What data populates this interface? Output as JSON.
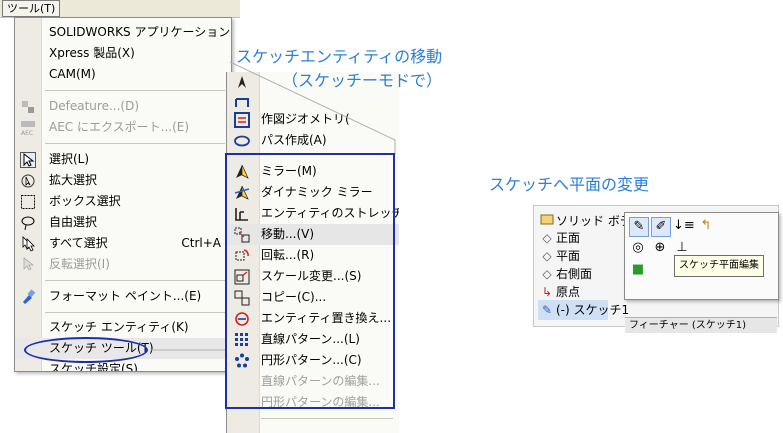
{
  "menubar": {
    "tools_menu": "ツール(T)"
  },
  "tools_menu_items": [
    {
      "label": "SOLIDWORKS アプリケーション(",
      "shortcut": "",
      "icon": "",
      "disabled": false
    },
    {
      "label": "Xpress 製品(X)",
      "shortcut": "",
      "icon": "",
      "disabled": false
    },
    {
      "label": "CAM(M)",
      "shortcut": "",
      "icon": "",
      "disabled": false
    },
    {
      "label": "Defeature...(D)",
      "shortcut": "",
      "icon": "defeature-icon",
      "disabled": true
    },
    {
      "label": "AEC にエクスポート...(E)",
      "shortcut": "",
      "icon": "aec-export-icon",
      "disabled": true
    },
    {
      "label": "選択(L)",
      "shortcut": "",
      "icon": "select-arrow-icon",
      "disabled": false
    },
    {
      "label": "拡大選択",
      "shortcut": "",
      "icon": "magnify-select-icon",
      "disabled": false
    },
    {
      "label": "ボックス選択",
      "shortcut": "",
      "icon": "box-select-icon",
      "disabled": false
    },
    {
      "label": "自由選択",
      "shortcut": "",
      "icon": "lasso-select-icon",
      "disabled": false
    },
    {
      "label": "すべて選択",
      "shortcut": "Ctrl+A",
      "icon": "select-all-icon",
      "disabled": false
    },
    {
      "label": "反転選択(I)",
      "shortcut": "",
      "icon": "invert-select-icon",
      "disabled": true
    },
    {
      "label": "フォーマット ペイント...(E)",
      "shortcut": "",
      "icon": "format-painter-icon",
      "disabled": false
    },
    {
      "label": "スケッチ エンティティ(K)",
      "shortcut": "",
      "icon": "",
      "disabled": false
    },
    {
      "label": "スケッチ ツール(T)",
      "shortcut": "",
      "icon": "",
      "disabled": false
    },
    {
      "label": "スケッチ設定(S)",
      "shortcut": "",
      "icon": "",
      "disabled": false
    }
  ],
  "sketch_tools_menu_items": [
    {
      "label": "",
      "icon": "",
      "disabled": false
    },
    {
      "label": "",
      "icon": "",
      "disabled": false
    },
    {
      "label": "作図ジオメトリ(",
      "icon": "construction-geometry-icon",
      "disabled": false
    },
    {
      "label": "パス作成(A)",
      "icon": "make-path-icon",
      "disabled": false
    },
    {
      "label": "ミラー(M)",
      "icon": "mirror-icon",
      "disabled": false
    },
    {
      "label": "ダイナミック ミラー",
      "icon": "dynamic-mirror-icon",
      "disabled": false
    },
    {
      "label": "エンティティのストレッチ(E)",
      "icon": "stretch-icon",
      "disabled": false
    },
    {
      "label": "移動...(V)",
      "icon": "move-entities-icon",
      "disabled": false
    },
    {
      "label": "回転...(R)",
      "icon": "rotate-entities-icon",
      "disabled": false
    },
    {
      "label": "スケール変更...(S)",
      "icon": "scale-entities-icon",
      "disabled": false
    },
    {
      "label": "コピー(C)...",
      "icon": "copy-entities-icon",
      "disabled": false
    },
    {
      "label": "エンティティ置き換え...",
      "icon": "replace-entity-icon",
      "disabled": false
    },
    {
      "label": "直線パターン...(L)",
      "icon": "linear-pattern-icon",
      "disabled": false
    },
    {
      "label": "円形パターン...(C)",
      "icon": "circular-pattern-icon",
      "disabled": false
    },
    {
      "label": "直線パターンの編集...",
      "icon": "",
      "disabled": true
    },
    {
      "label": "円形パターンの編集...",
      "icon": "",
      "disabled": true
    }
  ],
  "annotations": {
    "move_title_line1": "スケッチエンティティの移動",
    "move_title_line2": "（スケッチーモドで）",
    "plane_change_title": "スケッチへ平面の変更"
  },
  "feature_tree": {
    "items": [
      {
        "label": "ソリッド ボデ",
        "icon": "solid-bodies-icon"
      },
      {
        "label": "正面",
        "icon": "plane-icon"
      },
      {
        "label": "平面",
        "icon": "plane-icon"
      },
      {
        "label": "右側面",
        "icon": "plane-icon"
      },
      {
        "label": "原点",
        "icon": "origin-icon"
      },
      {
        "label": "(-) スケッチ1",
        "icon": "sketch-icon"
      }
    ],
    "bottom_label": "フィーチャー (スケッチ1)"
  },
  "context_toolbar": {
    "tooltip": "スケッチ平面編集"
  },
  "colors": {
    "annotation_blue": "#2b7fd8",
    "box_navy": "#1f2fa8"
  }
}
